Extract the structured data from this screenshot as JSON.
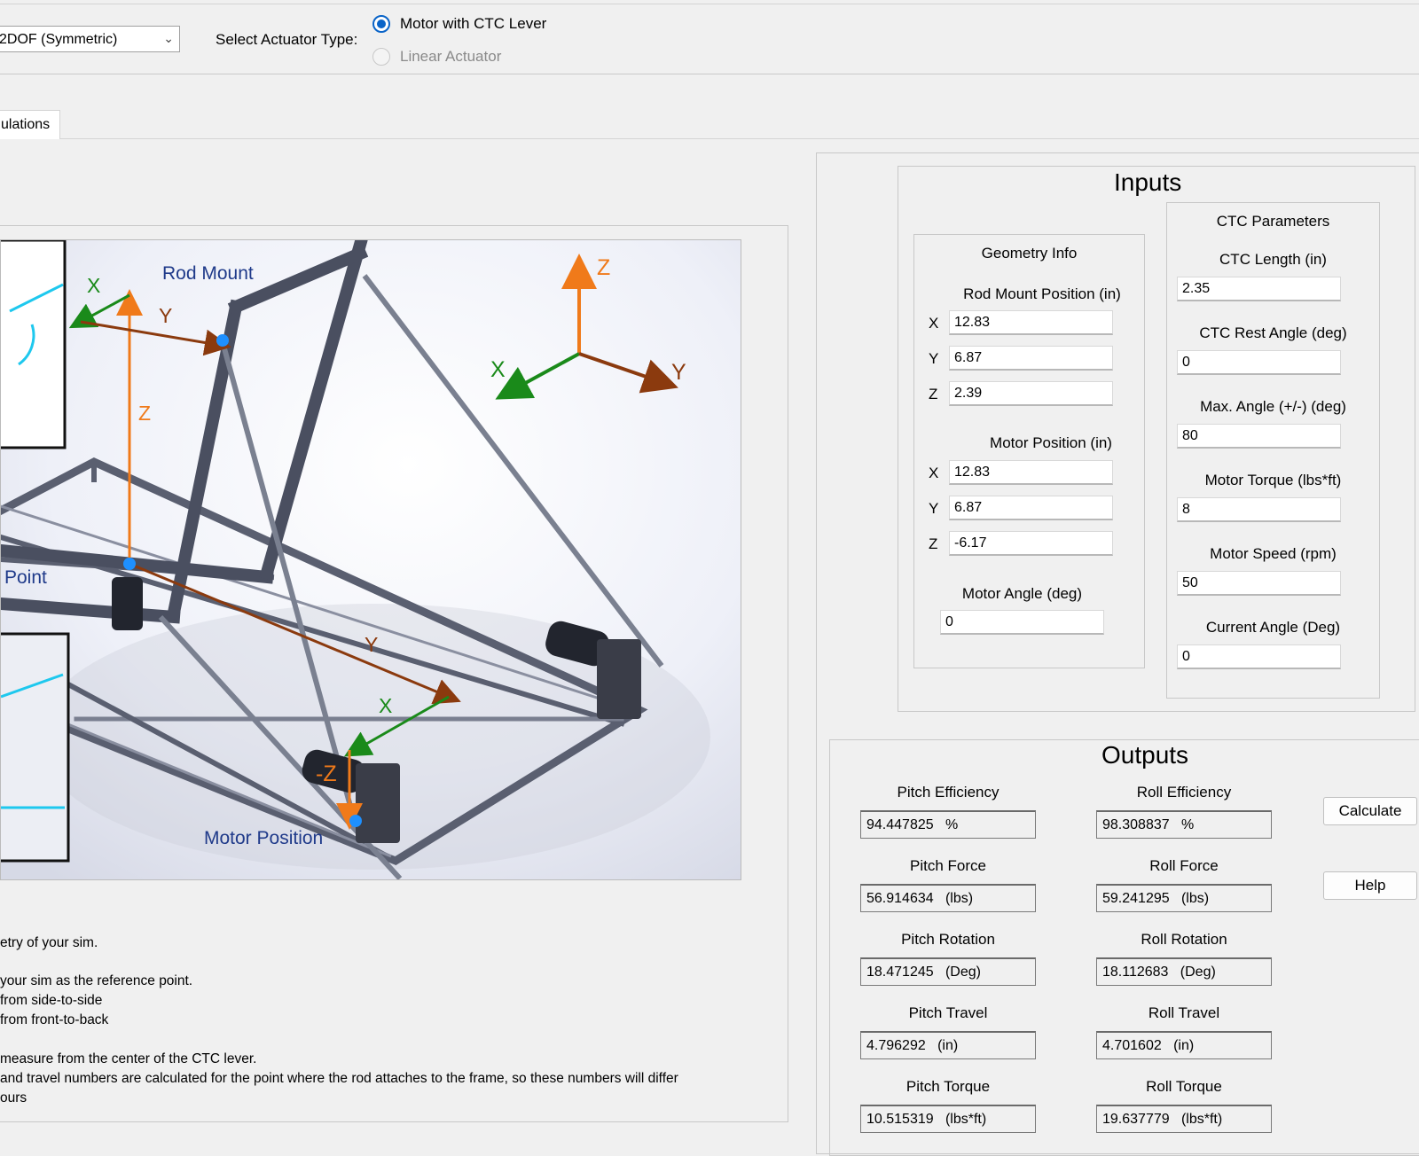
{
  "toolbar": {
    "sim_type_value": "2DOF (Symmetric)",
    "actuator_label": "Select Actuator Type:",
    "radio_motor": "Motor with CTC Lever",
    "radio_linear": "Linear Actuator"
  },
  "tabs": {
    "calculations": "ulations"
  },
  "diagram": {
    "labels": {
      "rod_mount": "Rod Mount",
      "motor_position": "Motor Position",
      "point": "Point",
      "x": "X",
      "y": "Y",
      "z": "Z",
      "neg_z": "-Z"
    },
    "colors": {
      "x_axis": "#1a8a1a",
      "y_axis": "#8b3a0e",
      "z_axis": "#f07a1a",
      "marker": "#1e90ff",
      "label_blue": "#1f3a8a",
      "cyan": "#1ec8ee"
    }
  },
  "description": {
    "line1": "etry of your sim.",
    "line2": " your sim as the reference point.",
    "line3": "from side-to-side",
    "line4": "from front-to-back",
    "line5": " measure from the center of the CTC lever.",
    "line6": "and travel numbers are calculated for the point where the rod attaches to the frame, so these numbers will differ",
    "line7": "ours"
  },
  "inputs": {
    "title": "Inputs",
    "geometry": {
      "title": "Geometry Info",
      "rod_mount_label": "Rod Mount Position (in)",
      "rod_x": "12.83",
      "rod_y": "6.87",
      "rod_z": "2.39",
      "motor_pos_label": "Motor Position (in)",
      "motor_x": "12.83",
      "motor_y": "6.87",
      "motor_z": "-6.17",
      "motor_angle_label": "Motor Angle (deg)",
      "motor_angle": "0",
      "x": "X",
      "y": "Y",
      "z": "Z"
    },
    "ctc": {
      "title": "CTC Parameters",
      "length_label": "CTC Length (in)",
      "length": "2.35",
      "rest_label": "CTC Rest Angle (deg)",
      "rest": "0",
      "max_label": "Max. Angle (+/-) (deg)",
      "max": "80",
      "torque_label": "Motor Torque (lbs*ft)",
      "torque": "8",
      "speed_label": "Motor Speed (rpm)",
      "speed": "50",
      "current_label": "Current Angle (Deg)",
      "current": "0"
    }
  },
  "outputs": {
    "title": "Outputs",
    "pitch_eff_label": "Pitch Efficiency",
    "pitch_eff": "94.447825   %",
    "roll_eff_label": "Roll Efficiency",
    "roll_eff": "98.308837   %",
    "pitch_force_label": "Pitch Force",
    "pitch_force": "56.914634   (lbs)",
    "roll_force_label": "Roll Force",
    "roll_force": "59.241295   (lbs)",
    "pitch_rot_label": "Pitch Rotation",
    "pitch_rot": "18.471245   (Deg)",
    "roll_rot_label": "Roll Rotation",
    "roll_rot": "18.112683   (Deg)",
    "pitch_travel_label": "Pitch Travel",
    "pitch_travel": "4.796292   (in)",
    "roll_travel_label": "Roll Travel",
    "roll_travel": "4.701602   (in)",
    "pitch_torque_label": "Pitch Torque",
    "pitch_torque": "10.515319   (lbs*ft)",
    "roll_torque_label": "Roll Torque",
    "roll_torque": "19.637779   (lbs*ft)",
    "calculate": "Calculate",
    "help": "Help"
  }
}
